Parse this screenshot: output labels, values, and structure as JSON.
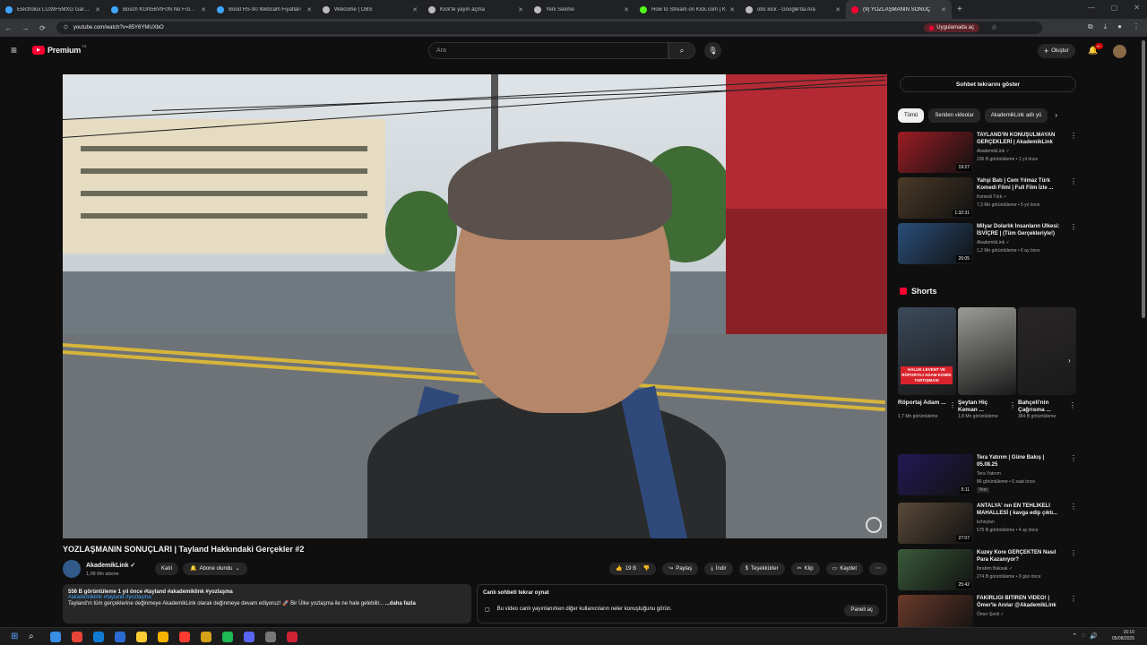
{
  "browser": {
    "tabs": [
      {
        "label": "Electrolux LU39F5MXG Gardıro",
        "icon": "tab-favicon",
        "color": "#3ea6ff",
        "active": false
      },
      {
        "label": "Bosch KGN56VIF0N No Frost K",
        "icon": "tab-favicon",
        "color": "#3ea6ff",
        "active": false
      },
      {
        "label": "Bood HS-90 Webcam Fiyatları",
        "icon": "tab-favicon",
        "color": "#3ea6ff",
        "active": false
      },
      {
        "label": "Welcome | OBS",
        "icon": "tab-favicon",
        "color": "#bbbbbb",
        "active": false
      },
      {
        "label": "Kick'te yayın açma",
        "icon": "tab-favicon",
        "color": "#bbbbbb",
        "active": false
      },
      {
        "label": "Yeni Sekme",
        "icon": "tab-favicon",
        "color": "#bbbbbb",
        "active": false
      },
      {
        "label": "How to Stream on Kick.com | K",
        "icon": "tab-favicon",
        "color": "#53fc18",
        "active": false
      },
      {
        "label": "obs kick - Google'da Ara",
        "icon": "tab-favicon",
        "color": "#bbbbbb",
        "active": false
      },
      {
        "label": "(9) YOZLAŞMANIN SONUÇ",
        "icon": "tab-favicon",
        "color": "#ff0033",
        "active": true
      }
    ],
    "url": "youtube.com/watch?v=85Y6YMUXbO",
    "open_app": "Uygulamada aç"
  },
  "header": {
    "premium": "Premium",
    "region": "TR",
    "search_placeholder": "Ara",
    "create": "Oluştur",
    "notif_badge": "9+"
  },
  "video": {
    "title": "YOZLAŞMANIN SONUÇLARI | Tayland Hakkındaki Gerçekler #2",
    "channel": "AkademikLink",
    "subs": "1,08 Mn abone",
    "join": "Katıl",
    "subscribed": "Abone olundu",
    "likes": "19 B",
    "share": "Paylaş",
    "download": "İndir",
    "thanks": "Teşekkürler",
    "clip": "Klip",
    "save": "Kaydet",
    "desc_line1": "556 B görüntüleme  1 yıl önce  #tayland #akademiklink #yozlaşma",
    "desc_tags": "#akademiklink #tayland #yozlaşma",
    "desc_line2": "Tayland'ın tüm gerçeklerine değinmeye AkademikLink olarak değinmeye devam ediyoruz! 🚀 Bir Ülke yozlaşma ile ne hale gelebilir...",
    "desc_more": "...daha fazla",
    "chat_title": "Canlı sohbeti tekrar oynat",
    "chat_msg": "Bu video canlı yayınlanırken diğer kullanıcıların neler konuştuğunu görün.",
    "chat_open": "Paneli aç"
  },
  "sidebar": {
    "chat_btn": "Sohbet tekrarını göster",
    "chips": [
      {
        "label": "Tümü",
        "active": true
      },
      {
        "label": "Seriden videolar",
        "active": false
      },
      {
        "label": "AkademikLink adlı yü",
        "active": false
      }
    ],
    "recs": [
      {
        "title": "TAYLAND'IN KONUŞULMAYAN GERÇEKLERİ | AkademikLink",
        "channel": "AkademikLink ✓",
        "meta": "236 B görüntüleme • 1 yıl önce",
        "duration": "19:27",
        "thumb": "#9c1d24"
      },
      {
        "title": "Yahşi Batı | Cem Yılmaz Türk Komedi Filmi | Full Film İzle ...",
        "channel": "Komedi Türk ✓",
        "meta": "7,3 Mn görüntüleme • 5 yıl önce",
        "duration": "1:32:31",
        "thumb": "#4a3a28"
      },
      {
        "title": "Milyar Dolarlık İnsanların Ülkesi: İSVİÇRE | (Tüm Gerçekleriyle!)",
        "channel": "AkademikLink ✓",
        "meta": "1,2 Mn görüntüleme • 6 ay önce",
        "duration": "26:05",
        "thumb": "#2a4f7a"
      }
    ],
    "shorts_title": "Shorts",
    "shorts": [
      {
        "title": "Röportaj Adam ...",
        "views": "1,7 Mn görüntüleme",
        "thumb": "#3c4a5c",
        "overlay": "HALUK LEVENT VE RÖPORTAJ ADAM KOMİK TARTIŞMASI"
      },
      {
        "title": "Şeytan Hiç Keman ...",
        "views": "1,8 Mn görüntüleme",
        "thumb": "#9a9a96",
        "overlay": ""
      },
      {
        "title": "Bahçeli'nin Çağrısına ...",
        "views": "384 B görüntüleme",
        "thumb": "#2a2628",
        "overlay": ""
      }
    ],
    "recs2": [
      {
        "title": "Tera Yatırım | Güne Bakış | 05.08.25",
        "channel": "Tera Yatırım",
        "meta": "86 görüntüleme • 6 saat önce",
        "duration": "5:11",
        "thumb": "#221a55",
        "new": "Yeni"
      },
      {
        "title": "ANTALYA' nın EN TEHLİKELİ MAHALLESİ ( kavga edip çıktı...",
        "channel": "kcheylan",
        "meta": "575 B görüntüleme • 4 ay önce",
        "duration": "27:07",
        "thumb": "#5a4a3a",
        "new": ""
      },
      {
        "title": "Kuzey Kore GERÇEKTEN Nasıl Para Kazanıyor?",
        "channel": "İbrahim Baksak ✓",
        "meta": "274 B görüntüleme • 9 gün önce",
        "duration": "25:42",
        "thumb": "#3a5a3a",
        "new": ""
      },
      {
        "title": "FAKİRLİĞİ BİTİREN VİDEO! | Ömer'le Anılar @AkademikLink",
        "channel": "Ömer Şenli ✓",
        "meta": "",
        "duration": "",
        "thumb": "#6a3a2a",
        "new": ""
      }
    ]
  },
  "taskbar": {
    "time": "16:10",
    "date": "05/08/2025",
    "apps": [
      "#3a8ee6",
      "#e8443a",
      "#0f7ad4",
      "#2b6cd4",
      "#ffcc33",
      "#f4b400",
      "#ff3b30",
      "#d4a017",
      "#1db954",
      "#5865f2",
      "#777777",
      "#cc2233"
    ]
  }
}
